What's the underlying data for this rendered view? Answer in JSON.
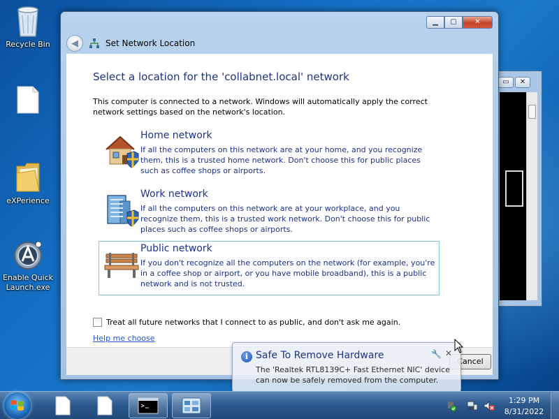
{
  "desktop": {
    "icons": [
      {
        "label": "Recycle Bin",
        "icon": "recycle-bin-icon"
      },
      {
        "label": "",
        "icon": "document-icon"
      },
      {
        "label": "eXPerience",
        "icon": "folder-icon"
      },
      {
        "label": "Enable Quick Launch.exe",
        "icon": "quick-launch-app-icon"
      }
    ]
  },
  "console_window": {
    "controls": [
      "minimize",
      "restore",
      "close"
    ]
  },
  "dialog": {
    "nav_title": "Set Network Location",
    "heading": "Select a location for the 'collabnet.local' network",
    "intro": "This computer is connected to a network. Windows will automatically apply the correct network settings based on the network's location.",
    "options": [
      {
        "title": "Home network",
        "description": "If all the computers on this network are at your home, and you recognize them, this is a trusted home network.  Don't choose this for public places such as coffee shops or airports.",
        "icon": "home-network-icon"
      },
      {
        "title": "Work network",
        "description": "If all the computers on this network are at your workplace, and you recognize them, this is a trusted work network.  Don't choose this for public places such as coffee shops or airports.",
        "icon": "work-network-icon"
      },
      {
        "title": "Public network",
        "description": "If you don't recognize all the computers on the network (for example, you're in a coffee shop or airport, or you have mobile broadband), this is a public network and is not trusted.",
        "icon": "public-network-bench-icon"
      }
    ],
    "checkbox_label": "Treat all future networks that I connect to as public, and don't ask me again.",
    "help_link": "Help me choose",
    "cancel_label": "Cancel"
  },
  "notification": {
    "title": "Safe To Remove Hardware",
    "message": "The 'Realtek RTL8139C+ Fast Ethernet NIC' device can now be safely removed from the computer."
  },
  "taskbar": {
    "clock_time": "1:29 PM",
    "clock_date": "8/31/2022"
  },
  "colors": {
    "heading_blue": "#1e3287",
    "link_blue": "#2255cc",
    "selection_border": "#7dc8dc",
    "close_button_red": "#c5442b"
  }
}
